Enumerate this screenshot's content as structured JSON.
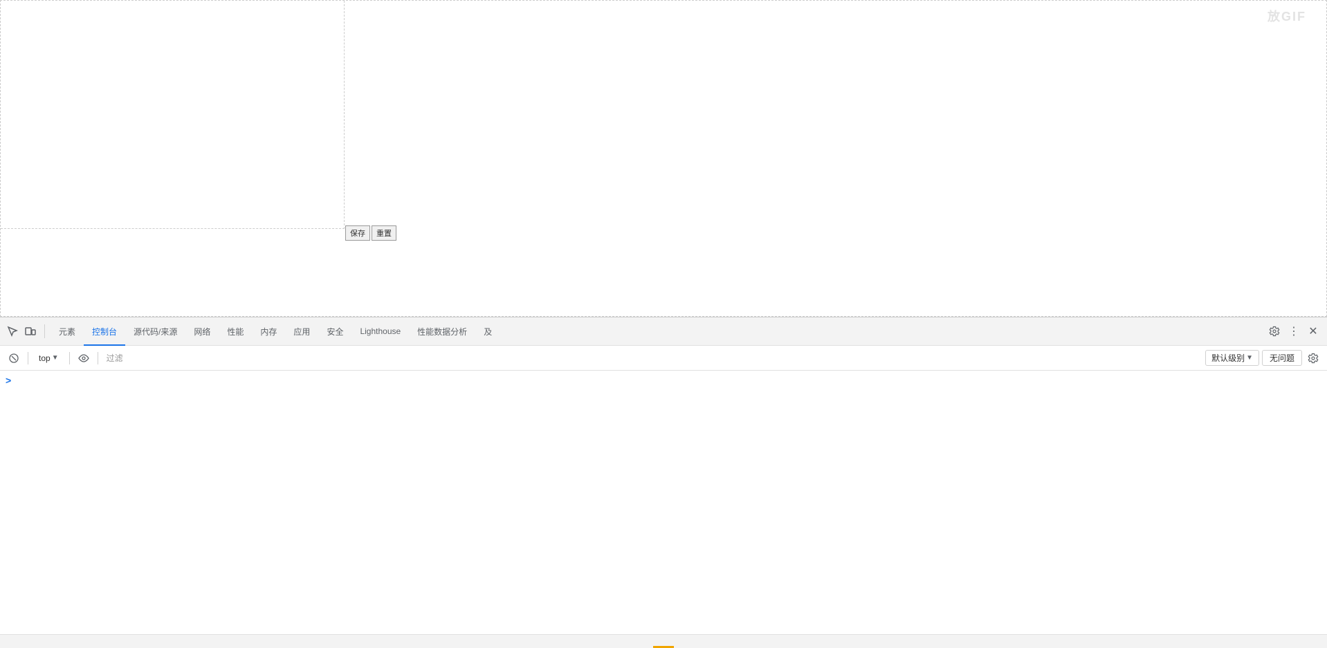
{
  "watermark": {
    "text": "放GIF"
  },
  "form_buttons": {
    "save": "保存",
    "reset": "重置"
  },
  "devtools": {
    "tabs": [
      {
        "id": "elements",
        "label": "元素",
        "active": false
      },
      {
        "id": "console",
        "label": "控制台",
        "active": true
      },
      {
        "id": "source",
        "label": "源代码/来源",
        "active": false
      },
      {
        "id": "network",
        "label": "网络",
        "active": false
      },
      {
        "id": "performance",
        "label": "性能",
        "active": false
      },
      {
        "id": "memory",
        "label": "内存",
        "active": false
      },
      {
        "id": "application",
        "label": "应用",
        "active": false
      },
      {
        "id": "security",
        "label": "安全",
        "active": false
      },
      {
        "id": "lighthouse",
        "label": "Lighthouse",
        "active": false
      },
      {
        "id": "perf-insights",
        "label": "性能数据分析",
        "active": false
      },
      {
        "id": "more",
        "label": "及",
        "active": false
      }
    ],
    "console": {
      "top_label": "top",
      "filter_placeholder": "过滤",
      "level_label": "默认级别",
      "no_issues_label": "无问题",
      "chevron": ">"
    }
  }
}
